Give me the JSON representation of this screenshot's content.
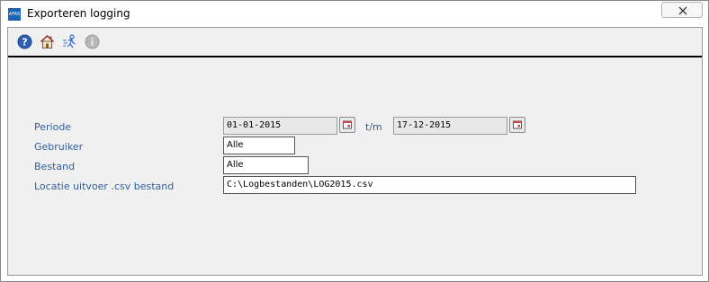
{
  "window": {
    "title": "Exporteren logging",
    "app_icon_text": "AFAS"
  },
  "toolbar": {
    "icons": [
      "help-icon",
      "home-icon",
      "run-icon",
      "info-icon"
    ]
  },
  "form": {
    "periode_label": "Periode",
    "periode_from": "01-01-2015",
    "tm_label": "t/m",
    "periode_to": "17-12-2015",
    "gebruiker_label": "Gebruiker",
    "gebruiker_value": "Alle",
    "bestand_label": "Bestand",
    "bestand_value": "Alle",
    "locatie_label": "Locatie uitvoer .csv bestand",
    "locatie_value": "C:\\Logbestanden\\LOG2015.csv"
  },
  "colors": {
    "label": "#2e5f9e",
    "panel_bg": "#f0f0f0",
    "help_blue": "#2f5fb3"
  }
}
